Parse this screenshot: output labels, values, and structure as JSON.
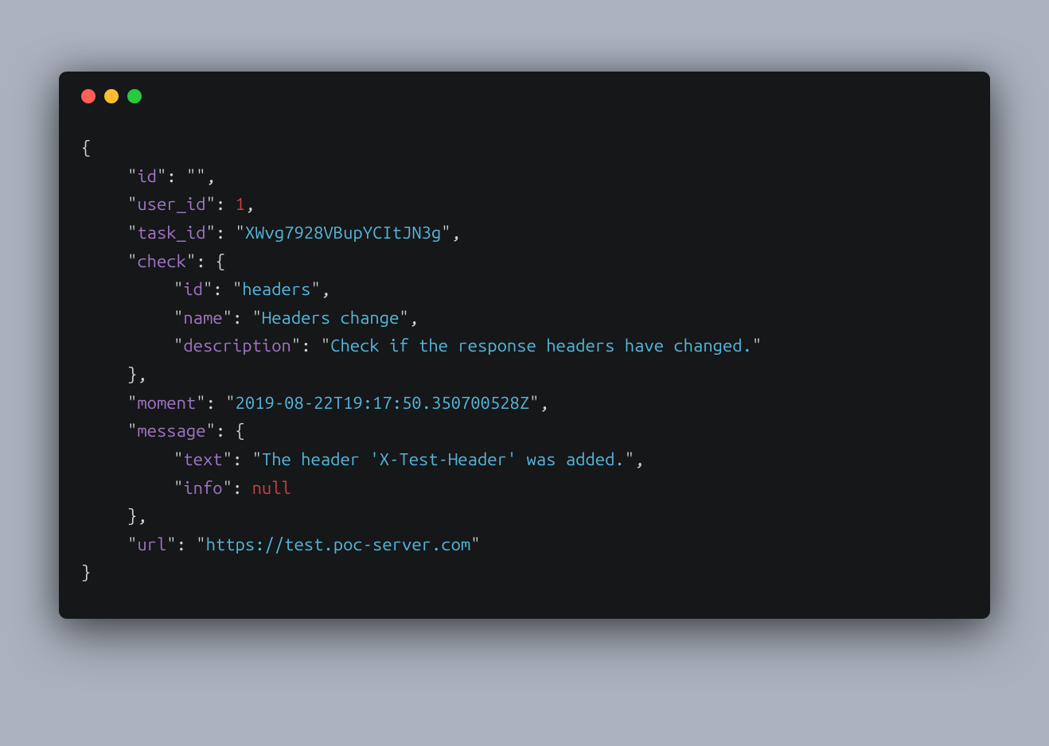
{
  "payload": {
    "id": "",
    "user_id": 1,
    "task_id": "XWvg7928VBupYCItJN3g",
    "check": {
      "id": "headers",
      "name": "Headers change",
      "description": "Check if the response headers have changed."
    },
    "moment": "2019-08-22T19:17:50.350700528Z",
    "message": {
      "text": "The header 'X-Test-Header' was added.",
      "info": null
    },
    "url": "https://test.poc-server.com"
  },
  "keys": {
    "id": "id",
    "user_id": "user_id",
    "task_id": "task_id",
    "check": "check",
    "check_id": "id",
    "check_name": "name",
    "check_description": "description",
    "moment": "moment",
    "message": "message",
    "message_text": "text",
    "message_info": "info",
    "url": "url"
  },
  "tokens": {
    "open_brace": "{",
    "close_brace": "}",
    "null_literal": "null"
  }
}
